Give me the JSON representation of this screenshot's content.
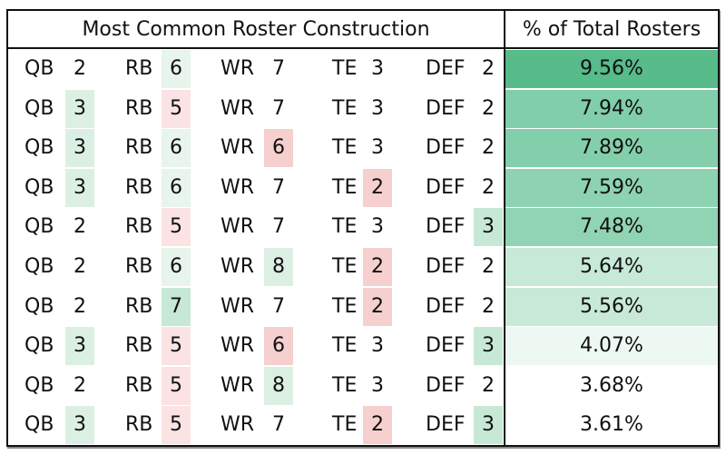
{
  "header": {
    "construction": "Most Common Roster Construction",
    "percent": "% of Total Rosters"
  },
  "colors": {
    "none": "transparent",
    "green1": "#e8f5ed",
    "green2": "#dcefe3",
    "green3": "#c8e8d6",
    "red1": "#fbe3e3",
    "red2": "#f5d0ce"
  },
  "rows": [
    {
      "qb": {
        "label": "QB",
        "value": "2",
        "tone": "none"
      },
      "rb": {
        "label": "RB",
        "value": "6",
        "tone": "green1"
      },
      "wr": {
        "label": "WR",
        "value": "7",
        "tone": "none"
      },
      "te": {
        "label": "TE",
        "value": "3",
        "tone": "none"
      },
      "def": {
        "label": "DEF",
        "value": "2",
        "tone": "none"
      },
      "percent": "9.56%",
      "percent_fill": "#57bb8a"
    },
    {
      "qb": {
        "label": "QB",
        "value": "3",
        "tone": "green2"
      },
      "rb": {
        "label": "RB",
        "value": "5",
        "tone": "red1"
      },
      "wr": {
        "label": "WR",
        "value": "7",
        "tone": "none"
      },
      "te": {
        "label": "TE",
        "value": "3",
        "tone": "none"
      },
      "def": {
        "label": "DEF",
        "value": "2",
        "tone": "none"
      },
      "percent": "7.94%",
      "percent_fill": "#81ceaa"
    },
    {
      "qb": {
        "label": "QB",
        "value": "3",
        "tone": "green2"
      },
      "rb": {
        "label": "RB",
        "value": "6",
        "tone": "green1"
      },
      "wr": {
        "label": "WR",
        "value": "6",
        "tone": "red2"
      },
      "te": {
        "label": "TE",
        "value": "3",
        "tone": "none"
      },
      "def": {
        "label": "DEF",
        "value": "2",
        "tone": "none"
      },
      "percent": "7.89%",
      "percent_fill": "#83cfab"
    },
    {
      "qb": {
        "label": "QB",
        "value": "3",
        "tone": "green2"
      },
      "rb": {
        "label": "RB",
        "value": "6",
        "tone": "green1"
      },
      "wr": {
        "label": "WR",
        "value": "7",
        "tone": "none"
      },
      "te": {
        "label": "TE",
        "value": "2",
        "tone": "red2"
      },
      "def": {
        "label": "DEF",
        "value": "2",
        "tone": "none"
      },
      "percent": "7.59%",
      "percent_fill": "#8dd3b1"
    },
    {
      "qb": {
        "label": "QB",
        "value": "2",
        "tone": "none"
      },
      "rb": {
        "label": "RB",
        "value": "5",
        "tone": "red1"
      },
      "wr": {
        "label": "WR",
        "value": "7",
        "tone": "none"
      },
      "te": {
        "label": "TE",
        "value": "3",
        "tone": "none"
      },
      "def": {
        "label": "DEF",
        "value": "3",
        "tone": "green3"
      },
      "percent": "7.48%",
      "percent_fill": "#90d4b3"
    },
    {
      "qb": {
        "label": "QB",
        "value": "2",
        "tone": "none"
      },
      "rb": {
        "label": "RB",
        "value": "6",
        "tone": "green1"
      },
      "wr": {
        "label": "WR",
        "value": "8",
        "tone": "green2"
      },
      "te": {
        "label": "TE",
        "value": "2",
        "tone": "red2"
      },
      "def": {
        "label": "DEF",
        "value": "2",
        "tone": "none"
      },
      "percent": "5.64%",
      "percent_fill": "#c7e9d7"
    },
    {
      "qb": {
        "label": "QB",
        "value": "2",
        "tone": "none"
      },
      "rb": {
        "label": "RB",
        "value": "7",
        "tone": "green3"
      },
      "wr": {
        "label": "WR",
        "value": "7",
        "tone": "none"
      },
      "te": {
        "label": "TE",
        "value": "2",
        "tone": "red2"
      },
      "def": {
        "label": "DEF",
        "value": "2",
        "tone": "none"
      },
      "percent": "5.56%",
      "percent_fill": "#c9e9d8"
    },
    {
      "qb": {
        "label": "QB",
        "value": "3",
        "tone": "green2"
      },
      "rb": {
        "label": "RB",
        "value": "5",
        "tone": "red1"
      },
      "wr": {
        "label": "WR",
        "value": "6",
        "tone": "red2"
      },
      "te": {
        "label": "TE",
        "value": "3",
        "tone": "none"
      },
      "def": {
        "label": "DEF",
        "value": "3",
        "tone": "green3"
      },
      "percent": "4.07%",
      "percent_fill": "#eef8f2"
    },
    {
      "qb": {
        "label": "QB",
        "value": "2",
        "tone": "none"
      },
      "rb": {
        "label": "RB",
        "value": "5",
        "tone": "red1"
      },
      "wr": {
        "label": "WR",
        "value": "8",
        "tone": "green2"
      },
      "te": {
        "label": "TE",
        "value": "3",
        "tone": "none"
      },
      "def": {
        "label": "DEF",
        "value": "2",
        "tone": "none"
      },
      "percent": "3.68%",
      "percent_fill": "#ffffff"
    },
    {
      "qb": {
        "label": "QB",
        "value": "3",
        "tone": "green2"
      },
      "rb": {
        "label": "RB",
        "value": "5",
        "tone": "red1"
      },
      "wr": {
        "label": "WR",
        "value": "7",
        "tone": "none"
      },
      "te": {
        "label": "TE",
        "value": "2",
        "tone": "red2"
      },
      "def": {
        "label": "DEF",
        "value": "3",
        "tone": "green3"
      },
      "percent": "3.61%",
      "percent_fill": "#ffffff"
    }
  ]
}
